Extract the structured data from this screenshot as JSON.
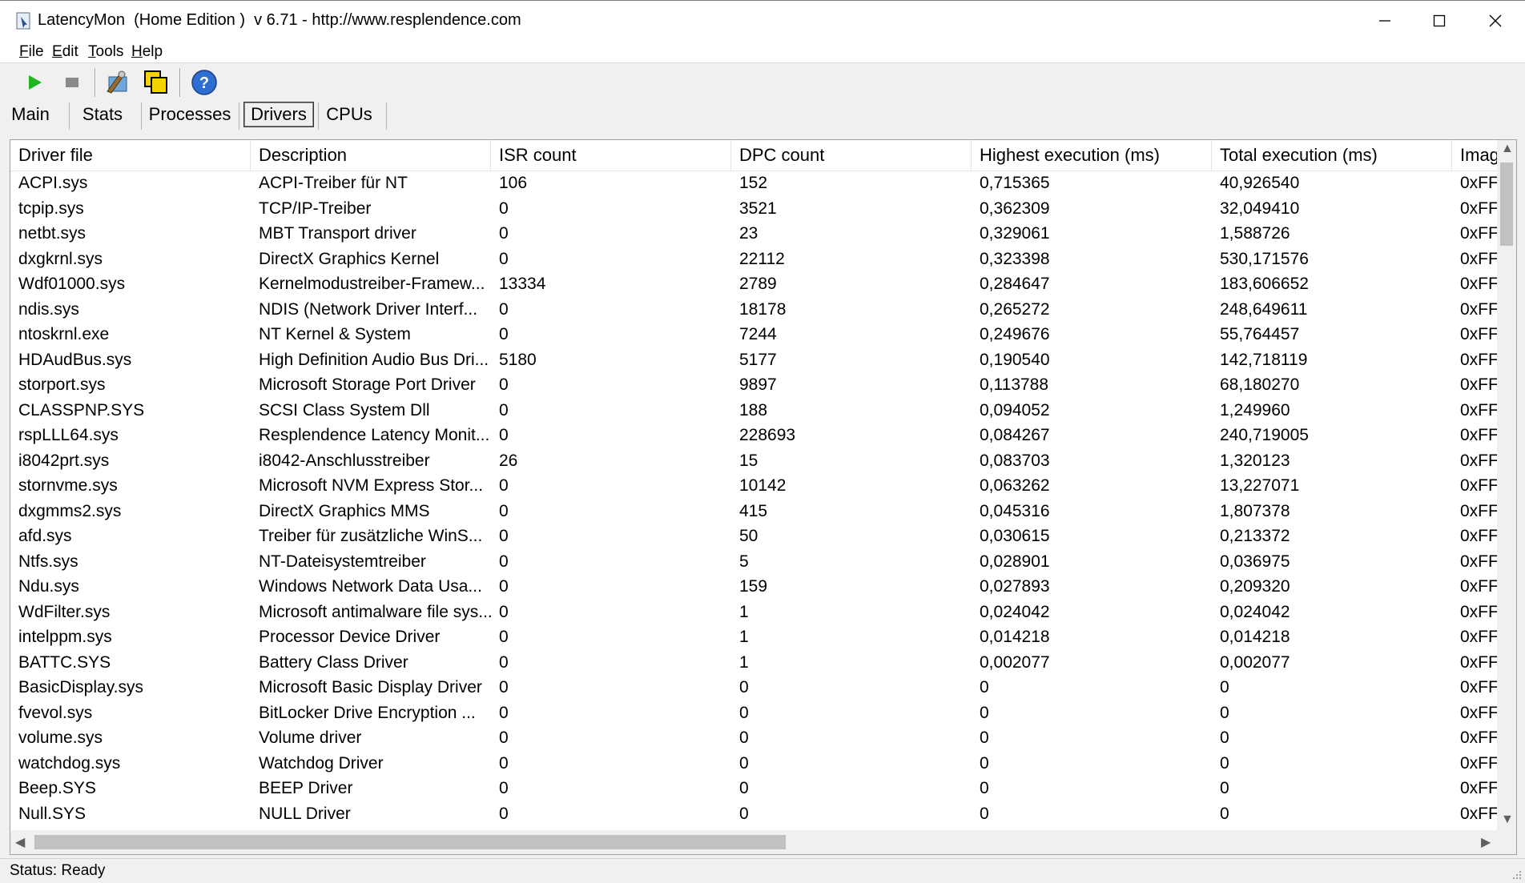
{
  "window": {
    "title": "LatencyMon  (Home Edition )  v 6.71 - http://www.resplendence.com"
  },
  "menu": [
    {
      "label": "File",
      "accel": "F",
      "rest": "ile"
    },
    {
      "label": "Edit",
      "accel": "E",
      "rest": "dit"
    },
    {
      "label": "Tools",
      "accel": "T",
      "rest": "ools"
    },
    {
      "label": "Help",
      "accel": "H",
      "rest": "elp"
    }
  ],
  "toolbar": {
    "icons": [
      "play-icon",
      "stop-icon",
      "tools-icon",
      "windows-icon",
      "help-icon"
    ],
    "accent_green": "#1fb51f",
    "help_blue": "#2d6fd1"
  },
  "tabs": [
    {
      "label": "Main",
      "active": false
    },
    {
      "label": "Stats",
      "active": false
    },
    {
      "label": "Processes",
      "active": false
    },
    {
      "label": "Drivers",
      "active": true
    },
    {
      "label": "CPUs",
      "active": false
    }
  ],
  "table": {
    "columns": [
      "Driver file",
      "Description",
      "ISR count",
      "DPC count",
      "Highest execution (ms)",
      "Total execution (ms)",
      "Imag"
    ],
    "rows": [
      [
        "ACPI.sys",
        "ACPI-Treiber für NT",
        "106",
        "152",
        "0,715365",
        "40,926540",
        "0xFF"
      ],
      [
        "tcpip.sys",
        "TCP/IP-Treiber",
        "0",
        "3521",
        "0,362309",
        "32,049410",
        "0xFF"
      ],
      [
        "netbt.sys",
        "MBT Transport driver",
        "0",
        "23",
        "0,329061",
        "1,588726",
        "0xFF"
      ],
      [
        "dxgkrnl.sys",
        "DirectX Graphics Kernel",
        "0",
        "22112",
        "0,323398",
        "530,171576",
        "0xFF"
      ],
      [
        "Wdf01000.sys",
        "Kernelmodustreiber-Framew...",
        "13334",
        "2789",
        "0,284647",
        "183,606652",
        "0xFF"
      ],
      [
        "ndis.sys",
        "NDIS (Network Driver Interf...",
        "0",
        "18178",
        "0,265272",
        "248,649611",
        "0xFF"
      ],
      [
        "ntoskrnl.exe",
        "NT Kernel & System",
        "0",
        "7244",
        "0,249676",
        "55,764457",
        "0xFF"
      ],
      [
        "HDAudBus.sys",
        "High Definition Audio Bus Dri...",
        "5180",
        "5177",
        "0,190540",
        "142,718119",
        "0xFF"
      ],
      [
        "storport.sys",
        "Microsoft Storage Port Driver",
        "0",
        "9897",
        "0,113788",
        "68,180270",
        "0xFF"
      ],
      [
        "CLASSPNP.SYS",
        "SCSI Class System Dll",
        "0",
        "188",
        "0,094052",
        "1,249960",
        "0xFF"
      ],
      [
        "rspLLL64.sys",
        "Resplendence Latency Monit...",
        "0",
        "228693",
        "0,084267",
        "240,719005",
        "0xFF"
      ],
      [
        "i8042prt.sys",
        "i8042-Anschlusstreiber",
        "26",
        "15",
        "0,083703",
        "1,320123",
        "0xFF"
      ],
      [
        "stornvme.sys",
        "Microsoft NVM Express Stor...",
        "0",
        "10142",
        "0,063262",
        "13,227071",
        "0xFF"
      ],
      [
        "dxgmms2.sys",
        "DirectX Graphics MMS",
        "0",
        "415",
        "0,045316",
        "1,807378",
        "0xFF"
      ],
      [
        "afd.sys",
        "Treiber für zusätzliche WinS...",
        "0",
        "50",
        "0,030615",
        "0,213372",
        "0xFF"
      ],
      [
        "Ntfs.sys",
        "NT-Dateisystemtreiber",
        "0",
        "5",
        "0,028901",
        "0,036975",
        "0xFF"
      ],
      [
        "Ndu.sys",
        "Windows Network Data Usa...",
        "0",
        "159",
        "0,027893",
        "0,209320",
        "0xFF"
      ],
      [
        "WdFilter.sys",
        "Microsoft antimalware file sys...",
        "0",
        "1",
        "0,024042",
        "0,024042",
        "0xFF"
      ],
      [
        "intelppm.sys",
        "Processor Device Driver",
        "0",
        "1",
        "0,014218",
        "0,014218",
        "0xFF"
      ],
      [
        "BATTC.SYS",
        "Battery Class Driver",
        "0",
        "1",
        "0,002077",
        "0,002077",
        "0xFF"
      ],
      [
        "BasicDisplay.sys",
        "Microsoft Basic Display Driver",
        "0",
        "0",
        "0",
        "0",
        "0xFF"
      ],
      [
        "fvevol.sys",
        "BitLocker Drive Encryption ...",
        "0",
        "0",
        "0",
        "0",
        "0xFF"
      ],
      [
        "volume.sys",
        "Volume driver",
        "0",
        "0",
        "0",
        "0",
        "0xFF"
      ],
      [
        "watchdog.sys",
        "Watchdog Driver",
        "0",
        "0",
        "0",
        "0",
        "0xFF"
      ],
      [
        "Beep.SYS",
        "BEEP Driver",
        "0",
        "0",
        "0",
        "0",
        "0xFF"
      ],
      [
        "Null.SYS",
        "NULL Driver",
        "0",
        "0",
        "0",
        "0",
        "0xFF"
      ]
    ]
  },
  "status": {
    "text": "Status: Ready"
  }
}
